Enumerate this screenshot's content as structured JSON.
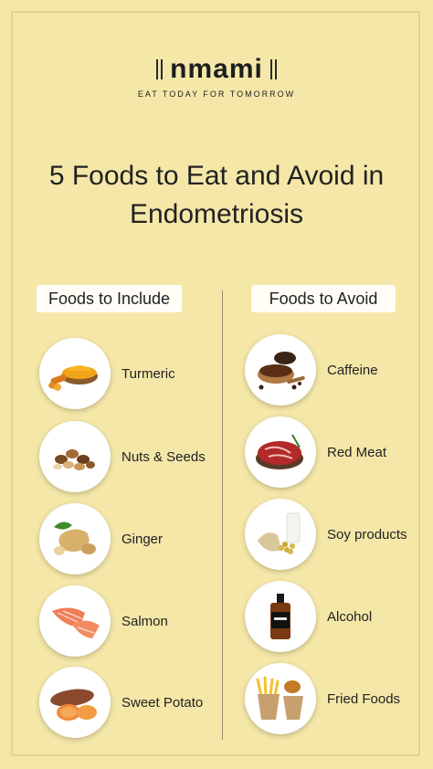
{
  "brand": {
    "name": "nmami",
    "tagline": "EAT TODAY FOR TOMORROW"
  },
  "title": {
    "line1": "5 Foods to Eat and Avoid in",
    "line2": "Endometriosis"
  },
  "include": {
    "heading": "Foods to Include",
    "items": [
      {
        "label": "Turmeric",
        "icon": "turmeric-icon"
      },
      {
        "label": "Nuts & Seeds",
        "icon": "nuts-icon"
      },
      {
        "label": "Ginger",
        "icon": "ginger-icon"
      },
      {
        "label": "Salmon",
        "icon": "salmon-icon"
      },
      {
        "label": "Sweet Potato",
        "icon": "sweet-potato-icon"
      }
    ]
  },
  "avoid": {
    "heading": "Foods to Avoid",
    "items": [
      {
        "label": "Caffeine",
        "icon": "coffee-icon"
      },
      {
        "label": "Red Meat",
        "icon": "steak-icon"
      },
      {
        "label": "Soy products",
        "icon": "soy-icon"
      },
      {
        "label": "Alcohol",
        "icon": "whiskey-bottle-icon"
      },
      {
        "label": "Fried Foods",
        "icon": "fries-icon"
      }
    ]
  },
  "colors": {
    "background": "#f4e7a8",
    "text": "#1e1e1e",
    "heading_box": "#fffdf6"
  }
}
